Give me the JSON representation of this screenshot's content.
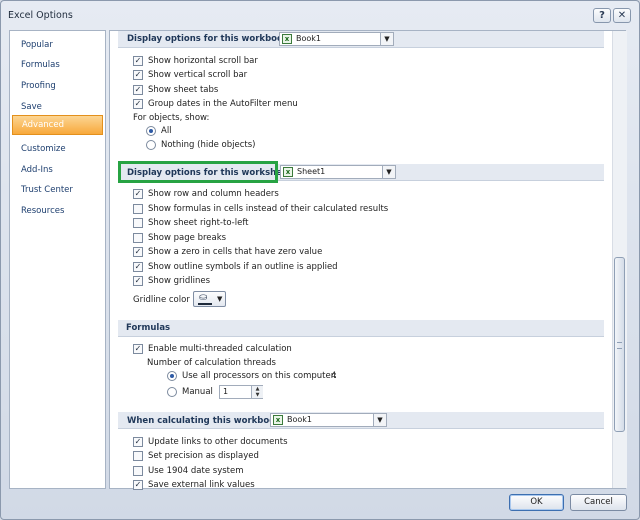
{
  "window": {
    "title": "Excel Options",
    "help_label": "?",
    "close_label": "✕"
  },
  "nav": {
    "items": [
      {
        "label": "Popular"
      },
      {
        "label": "Formulas"
      },
      {
        "label": "Proofing"
      },
      {
        "label": "Save"
      },
      {
        "label": "Advanced",
        "selected": true
      },
      {
        "label": "Customize"
      },
      {
        "label": "Add-Ins"
      },
      {
        "label": "Trust Center"
      },
      {
        "label": "Resources"
      }
    ]
  },
  "workbook_display": {
    "header": "Display options for this workbook:",
    "workbook": "Book1",
    "options": [
      {
        "label": "Show horizontal scroll bar",
        "checked": true
      },
      {
        "label": "Show vertical scroll bar",
        "checked": true
      },
      {
        "label": "Show sheet tabs",
        "checked": true
      },
      {
        "label": "Group dates in the AutoFilter menu",
        "checked": true
      }
    ],
    "objects_label": "For objects, show:",
    "objects_options": [
      {
        "label": "All",
        "selected": true
      },
      {
        "label": "Nothing (hide objects)",
        "selected": false
      }
    ]
  },
  "worksheet_display": {
    "header": "Display options for this worksheet:",
    "sheet": "Sheet1",
    "options": [
      {
        "label": "Show row and column headers",
        "checked": true
      },
      {
        "label": "Show formulas in cells instead of their calculated results",
        "checked": false
      },
      {
        "label": "Show sheet right-to-left",
        "checked": false
      },
      {
        "label": "Show page breaks",
        "checked": false
      },
      {
        "label": "Show a zero in cells that have zero value",
        "checked": true
      },
      {
        "label": "Show outline symbols if an outline is applied",
        "checked": true
      },
      {
        "label": "Show gridlines",
        "checked": true
      }
    ],
    "gridline_color_label": "Gridline color"
  },
  "formulas": {
    "header": "Formulas",
    "multithread_label": "Enable multi-threaded calculation",
    "multithread_checked": true,
    "threads_label": "Number of calculation threads",
    "use_all_label": "Use all processors on this computer:",
    "processor_count": "4",
    "manual_label": "Manual",
    "manual_value": "1"
  },
  "calc_workbook": {
    "header": "When calculating this workbook:",
    "workbook": "Book1",
    "options": [
      {
        "label": "Update links to other documents",
        "checked": true
      },
      {
        "label": "Set precision as displayed",
        "checked": false
      },
      {
        "label": "Use 1904 date system",
        "checked": false
      },
      {
        "label": "Save external link values",
        "checked": true
      }
    ]
  },
  "footer": {
    "ok_label": "OK",
    "cancel_label": "Cancel"
  },
  "colors": {
    "selected_nav": "#f8a93c",
    "highlight_border": "#27a343",
    "section_bg": "#e4e9f1"
  }
}
